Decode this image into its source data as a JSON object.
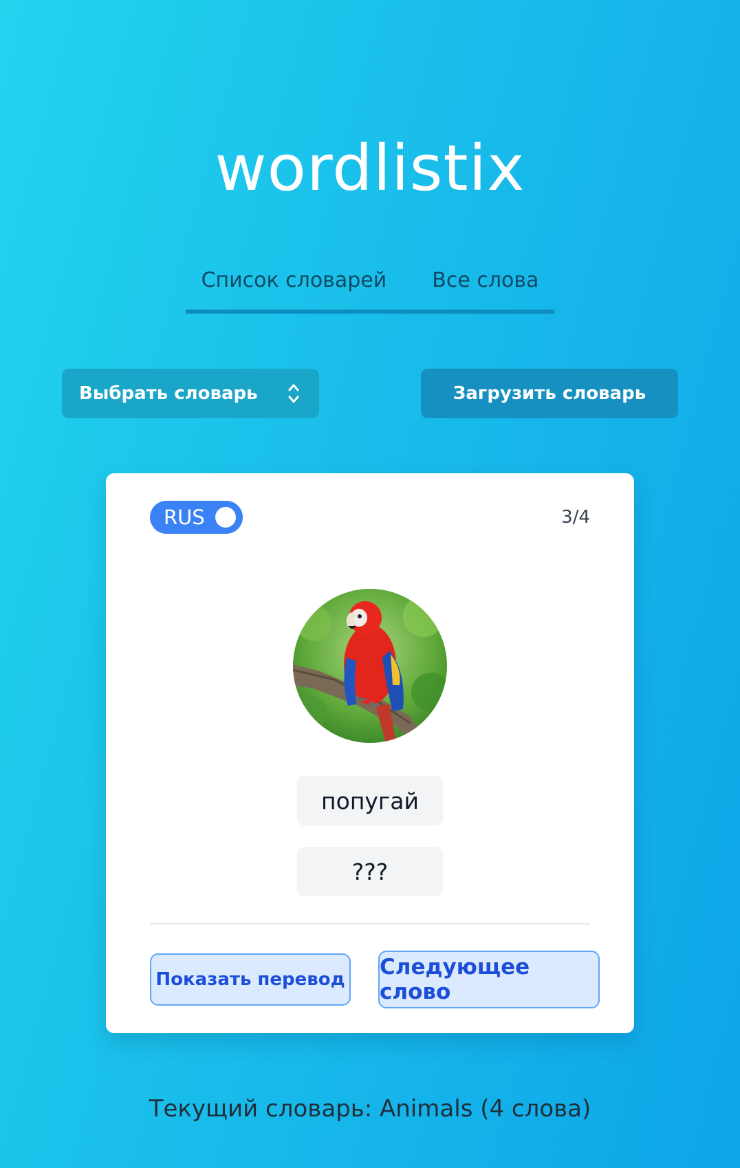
{
  "app": {
    "title": "wordlistix"
  },
  "tabs": [
    {
      "label": "Список словарей"
    },
    {
      "label": "Все слова"
    }
  ],
  "controls": {
    "select_label": "Выбрать словарь",
    "upload_label": "Загрузить словарь"
  },
  "card": {
    "language": "RUS",
    "counter": "3/4",
    "word": "попугай",
    "translation": "???",
    "show_translation_label": "Показать перевод",
    "next_word_label": "Следующее слово"
  },
  "footer": {
    "status": "Текущий словарь: Animals (4 слова)"
  },
  "colors": {
    "accent_blue": "#3b82f6",
    "button_teal": "#1aa6c9",
    "button_blue": "#1590c0",
    "action_bg": "#dbeafe",
    "action_text": "#1d4ed8"
  }
}
